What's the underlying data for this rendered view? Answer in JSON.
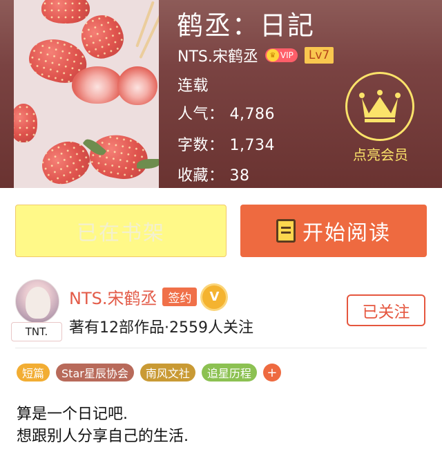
{
  "book": {
    "title": "鹤丞：日記",
    "author": "NTS.宋鹤丞",
    "vip_label": "VIP",
    "level": "Lv7",
    "status": "连载",
    "popularity_label": "人气：",
    "popularity": "4,786",
    "words_label": "字数：",
    "words": "1,734",
    "favorites_label": "收藏：",
    "favorites": "38"
  },
  "member": {
    "label": "点亮会员",
    "icon": "crown-icon"
  },
  "actions": {
    "shelf_label": "已在书架",
    "read_label": "开始阅读",
    "read_icon": "book-icon"
  },
  "author": {
    "name": "NTS.宋鹤丞",
    "sign_badge": "签约",
    "verified_badge": "V",
    "avatar_tag": "TNT.",
    "stats": "著有12部作品·2559人关注",
    "follow_label": "已关注"
  },
  "tags": [
    {
      "label": "短篇",
      "color": "#f2ad33"
    },
    {
      "label": "Star星辰协会",
      "color": "#b86a5a"
    },
    {
      "label": "南风文社",
      "color": "#c99a34"
    },
    {
      "label": "追星历程",
      "color": "#8cc152"
    },
    {
      "label": "+",
      "color": "#ee6a40"
    }
  ],
  "description": {
    "line1": "算是一个日记吧.",
    "line2": "想跟别人分享自己的生活."
  },
  "colors": {
    "accent": "#ee6a40",
    "header_bg": "#7a4342",
    "gold": "#fbe36a"
  }
}
